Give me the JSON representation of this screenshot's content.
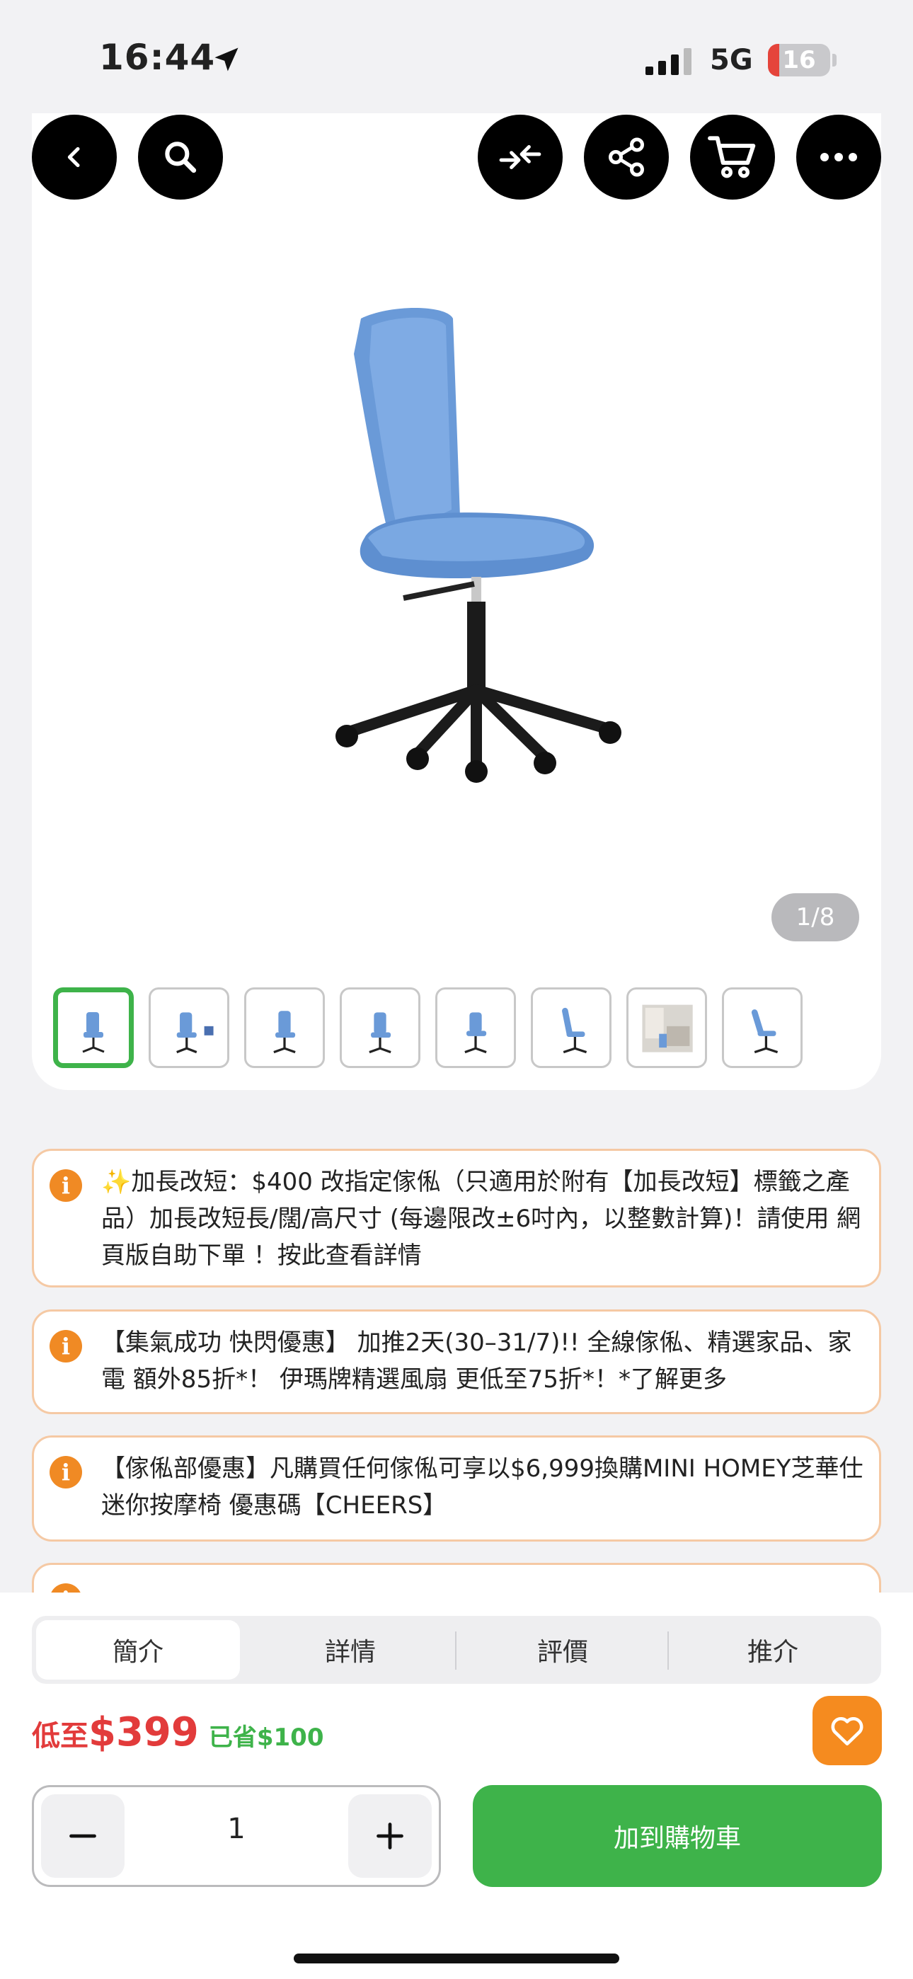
{
  "status_bar": {
    "time": "16:44",
    "network": "5G",
    "battery": "16"
  },
  "gallery": {
    "counter": "1/8",
    "thumbnail_count": 8
  },
  "notices": [
    {
      "text": "✨加長改短：$400 改指定傢俬（只適用於附有【加長改短】標籤之產品）加長改短長/闊/高尺寸 (每邊限改±6吋內，以整數計算)！請使用 網頁版自助下單 ！按此查看詳情"
    },
    {
      "text": "【集氣成功 快閃優惠】 加推2天(30–31/7)!! 全線傢俬、精選家品、家電 額外85折*！ 伊瑪牌精選風扇 更低至75折*！*了解更多"
    },
    {
      "text": "【傢俬部優惠】凡購買任何傢俬可享以$6,999換購MINI HOMEY芝華仕迷你按摩椅 優惠碼【CHEERS】"
    }
  ],
  "tabs": [
    {
      "label": "簡介",
      "active": true
    },
    {
      "label": "詳情",
      "active": false
    },
    {
      "label": "評價",
      "active": false
    },
    {
      "label": "推介",
      "active": false
    }
  ],
  "price": {
    "prefix": "低至",
    "value": "$399",
    "saved": "已省$100"
  },
  "quantity": {
    "value": "1"
  },
  "add_to_cart_label": "加到購物車",
  "colors": {
    "accent_green": "#3eb34a",
    "price_red": "#e23b3b",
    "fav_orange": "#f58b1f",
    "info_orange": "#f08a24"
  }
}
